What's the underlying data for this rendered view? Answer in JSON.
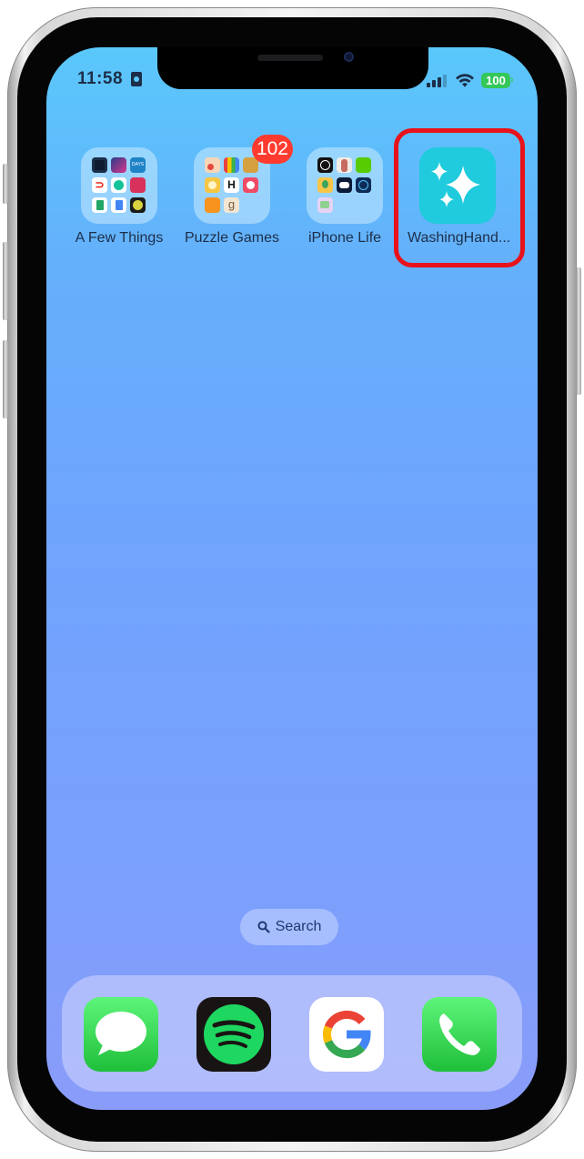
{
  "status_bar": {
    "time": "11:58",
    "focus_icon": "id-card-icon",
    "signal_bars": 3,
    "signal_total": 4,
    "wifi": "wifi-icon",
    "battery_level": "100",
    "battery_color": "#34c759"
  },
  "home_screen": {
    "apps": [
      {
        "label": "A Few Things",
        "type": "folder",
        "contents": [
          "screen-time",
          "shortcuts",
          "days",
          "doordash",
          "grammarly",
          "airmail",
          "google-sheets",
          "google-docs",
          "pcalc"
        ]
      },
      {
        "label": "Puzzle Games",
        "type": "folder",
        "badge": "102",
        "contents": [
          "two-dots",
          "color-sort",
          "bee",
          "bee-game",
          "h",
          "tomato",
          "orange",
          "g"
        ]
      },
      {
        "label": "iPhone Life",
        "type": "folder",
        "contents": [
          "globe",
          "anatomy",
          "duolingo",
          "maps-pin",
          "robot",
          "refresh",
          "messages-app"
        ]
      },
      {
        "label": "WashingHand...",
        "type": "app",
        "icon": "sparkles-icon",
        "highlighted": true
      }
    ],
    "highlight_color": "#e8121b",
    "badge_color": "#ff3b30"
  },
  "search": {
    "label": "Search",
    "icon": "search-icon"
  },
  "dock": {
    "apps": [
      {
        "name": "Messages",
        "icon": "messages-icon"
      },
      {
        "name": "Spotify",
        "icon": "spotify-icon"
      },
      {
        "name": "Google",
        "icon": "google-icon"
      },
      {
        "name": "Phone",
        "icon": "phone-icon"
      }
    ]
  }
}
